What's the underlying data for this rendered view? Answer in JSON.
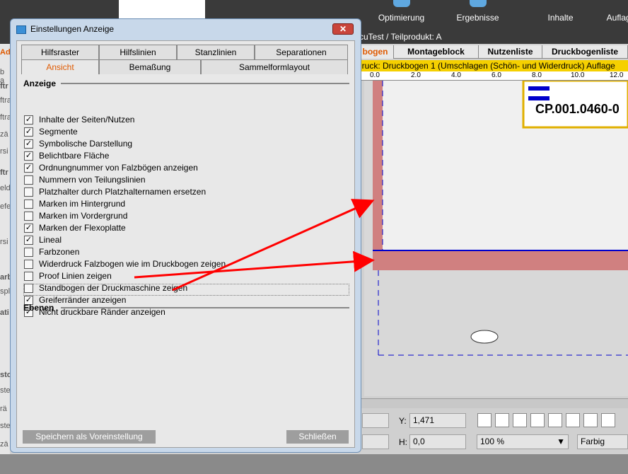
{
  "app": {
    "top_tabs": [
      "Optimierung",
      "Ergebnisse",
      "Inhalte",
      "Auflage"
    ],
    "subtitle": "cuTest / Teilprodukt: A",
    "tabs2": [
      "bogen",
      "Montageblock",
      "Nutzenliste",
      "Druckbogenliste"
    ],
    "status_text": "druck:  Druckbogen 1 (Umschlagen (Schön- und Widerdruck) Auflage",
    "ruler_ticks": [
      "0.0",
      "2.0",
      "4.0",
      "6.0",
      "8.0",
      "10.0",
      "12.0"
    ],
    "canvas_label": "CP.001.0460-0",
    "left_strip_chars": [
      "Ad",
      "b a",
      "ftr",
      "ftra",
      "ftra",
      "zä",
      "rsi",
      "ftr",
      "eld",
      "efe",
      "rsi",
      "arb",
      "spl",
      "ati",
      "sto",
      "ste",
      "rä",
      "ste",
      "zä"
    ],
    "fields": {
      "y_label": "Y:",
      "y_value": "1,471",
      "h_label": "H:",
      "h_value": "0,0",
      "zoom": "100 %",
      "color_mode": "Farbig"
    }
  },
  "dialog": {
    "title": "Einstellungen Anzeige",
    "close": "✕",
    "tabs_row1": [
      "Hilfsraster",
      "Hilfslinien",
      "Stanzlinien",
      "Separationen"
    ],
    "tabs_row2": [
      "Ansicht",
      "Bemaßung",
      "Sammelformlayout"
    ],
    "section_anzeige": "Anzeige",
    "section_ebenen": "Ebenen",
    "checkboxes": [
      {
        "label": "Inhalte der Seiten/Nutzen",
        "checked": true
      },
      {
        "label": "Segmente",
        "checked": true
      },
      {
        "label": "Symbolische Darstellung",
        "checked": true
      },
      {
        "label": "Belichtbare Fläche",
        "checked": true
      },
      {
        "label": "Ordnungnummer von Falzbögen anzeigen",
        "checked": true
      },
      {
        "label": "Nummern von Teilungslinien",
        "checked": false
      },
      {
        "label": "Platzhalter durch Platzhalternamen ersetzen",
        "checked": false
      },
      {
        "label": "Marken im Hintergrund",
        "checked": false
      },
      {
        "label": "Marken im Vordergrund",
        "checked": false
      },
      {
        "label": "Marken der Flexoplatte",
        "checked": true
      },
      {
        "label": "Lineal",
        "checked": true
      },
      {
        "label": "Farbzonen",
        "checked": false
      },
      {
        "label": "Widerdruck Falzbogen wie im Druckbogen zeigen",
        "checked": false
      },
      {
        "label": "Proof Linien zeigen",
        "checked": false
      },
      {
        "label": "Standbogen der Druckmaschine zeigen",
        "checked": false
      },
      {
        "label": "Greiferränder anzeigen",
        "checked": true
      },
      {
        "label": "Nicht druckbare Ränder anzeigen",
        "checked": true
      }
    ],
    "save_default": "Speichern als Voreinstellung",
    "close_btn": "Schließen"
  },
  "colors": {
    "annotation_arrow": "#ff0000",
    "gripper_margin": "#d08080",
    "status_bar": "#f5d000"
  }
}
